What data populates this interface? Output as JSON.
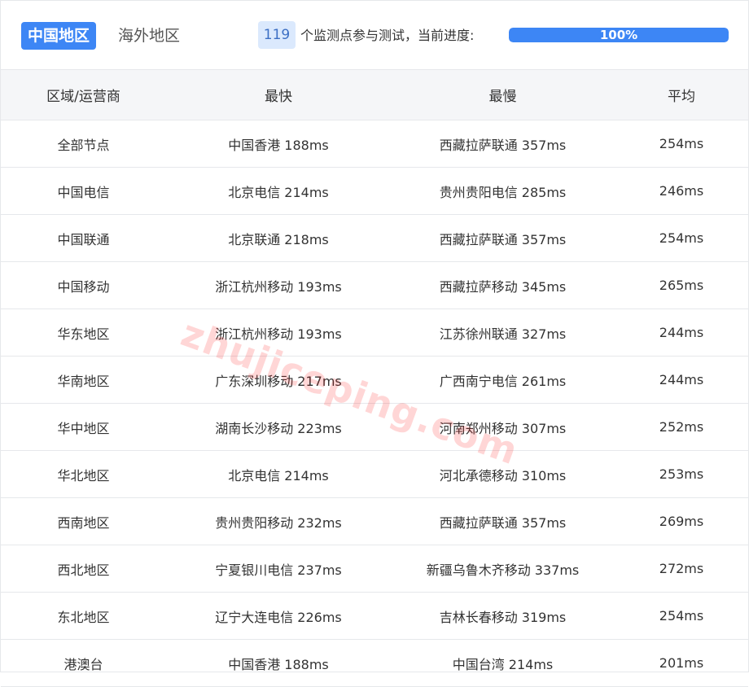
{
  "tabs": {
    "active": "中国地区",
    "inactive": "海外地区"
  },
  "progress": {
    "node_count": "119",
    "text": "个监测点参与测试，当前进度:",
    "percent_label": "100%",
    "percent": 100
  },
  "table": {
    "headers": [
      "区域/运营商",
      "最快",
      "最慢",
      "平均"
    ],
    "rows": [
      [
        "全部节点",
        "中国香港 188ms",
        "西藏拉萨联通 357ms",
        "254ms"
      ],
      [
        "中国电信",
        "北京电信 214ms",
        "贵州贵阳电信 285ms",
        "246ms"
      ],
      [
        "中国联通",
        "北京联通 218ms",
        "西藏拉萨联通 357ms",
        "254ms"
      ],
      [
        "中国移动",
        "浙江杭州移动 193ms",
        "西藏拉萨移动 345ms",
        "265ms"
      ],
      [
        "华东地区",
        "浙江杭州移动 193ms",
        "江苏徐州联通 327ms",
        "244ms"
      ],
      [
        "华南地区",
        "广东深圳移动 217ms",
        "广西南宁电信 261ms",
        "244ms"
      ],
      [
        "华中地区",
        "湖南长沙移动 223ms",
        "河南郑州移动 307ms",
        "252ms"
      ],
      [
        "华北地区",
        "北京电信 214ms",
        "河北承德移动 310ms",
        "253ms"
      ],
      [
        "西南地区",
        "贵州贵阳移动 232ms",
        "西藏拉萨联通 357ms",
        "269ms"
      ],
      [
        "西北地区",
        "宁夏银川电信 237ms",
        "新疆乌鲁木齐移动 337ms",
        "272ms"
      ],
      [
        "东北地区",
        "辽宁大连电信 226ms",
        "吉林长春移动 319ms",
        "254ms"
      ],
      [
        "港澳台",
        "中国香港 188ms",
        "中国台湾 214ms",
        "201ms"
      ]
    ]
  },
  "watermark": "zhujiceping.com",
  "colors": {
    "accent": "#3d86f5",
    "badge_bg": "#dbe9fd",
    "header_bg": "#f5f6f8"
  }
}
